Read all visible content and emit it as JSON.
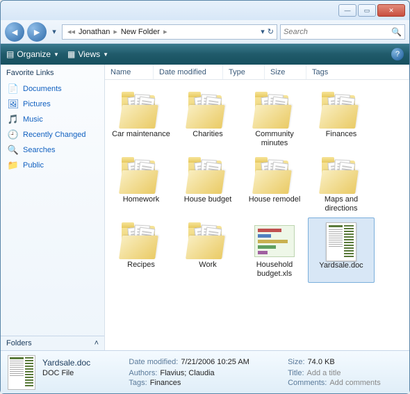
{
  "breadcrumb": {
    "seg1": "Jonathan",
    "seg2": "New Folder"
  },
  "search": {
    "placeholder": "Search"
  },
  "toolbar": {
    "organize": "Organize",
    "views": "Views"
  },
  "sidebar": {
    "header": "Favorite Links",
    "items": [
      {
        "label": "Documents"
      },
      {
        "label": "Pictures"
      },
      {
        "label": "Music"
      },
      {
        "label": "Recently Changed"
      },
      {
        "label": "Searches"
      },
      {
        "label": "Public"
      }
    ],
    "folders": "Folders"
  },
  "columns": {
    "name": "Name",
    "date": "Date modified",
    "type": "Type",
    "size": "Size",
    "tags": "Tags"
  },
  "items": [
    {
      "label": "Car maintenance",
      "kind": "folder"
    },
    {
      "label": "Charities",
      "kind": "folder"
    },
    {
      "label": "Community minutes",
      "kind": "folder"
    },
    {
      "label": "Finances",
      "kind": "folder"
    },
    {
      "label": "Homework",
      "kind": "folder"
    },
    {
      "label": "House budget",
      "kind": "folder"
    },
    {
      "label": "House remodel",
      "kind": "folder"
    },
    {
      "label": "Maps and directions",
      "kind": "folder"
    },
    {
      "label": "Recipes",
      "kind": "folder"
    },
    {
      "label": "Work",
      "kind": "folder"
    },
    {
      "label": "Household budget.xls",
      "kind": "xls"
    },
    {
      "label": "Yardsale.doc",
      "kind": "doc",
      "selected": true
    }
  ],
  "details": {
    "filename": "Yardsale.doc",
    "filetype": "DOC File",
    "labels": {
      "date": "Date modified:",
      "authors": "Authors:",
      "tags": "Tags:",
      "size": "Size:",
      "title": "Title:",
      "comments": "Comments:"
    },
    "date": "7/21/2006 10:25 AM",
    "authors": "Flavius; Claudia",
    "tags": "Finances",
    "size": "74.0 KB",
    "title": "Add a title",
    "comments": "Add comments"
  }
}
